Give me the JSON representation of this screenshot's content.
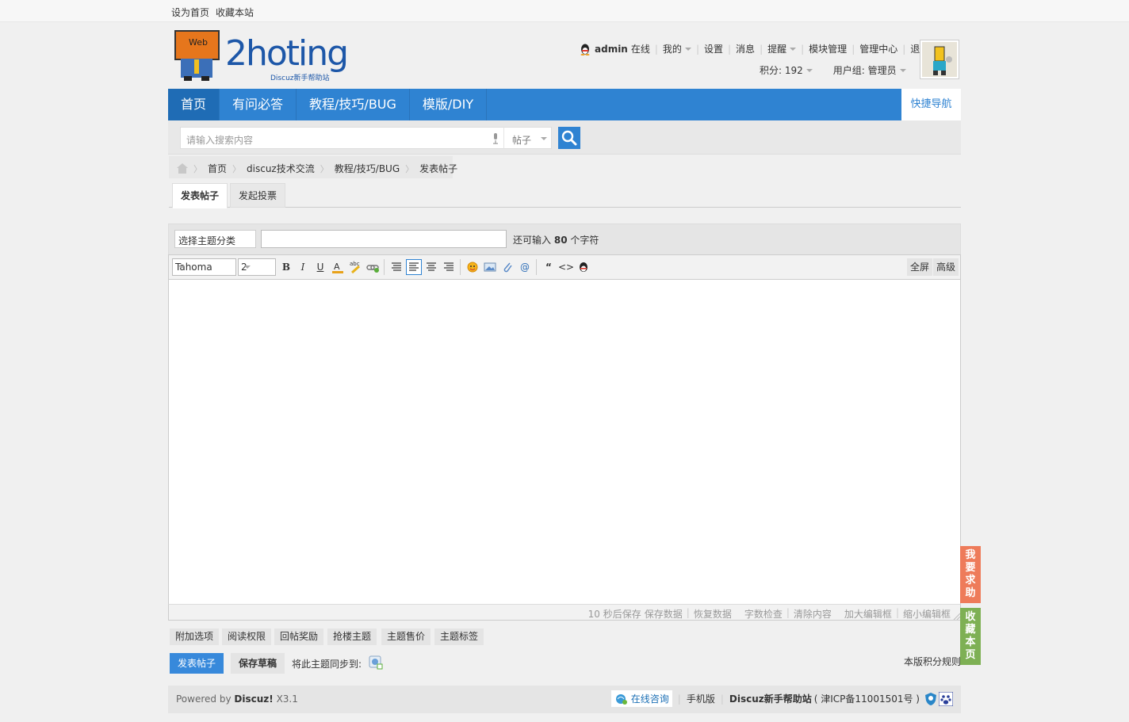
{
  "topbar": {
    "set_home": "设为首页",
    "bookmark": "收藏本站"
  },
  "logo": {
    "word": "2hoting",
    "sub": "Discuz新手帮助站",
    "sign": "Web"
  },
  "user": {
    "name": "admin",
    "status": "在线",
    "menu": [
      "我的",
      "设置",
      "消息",
      "提醒",
      "模块管理",
      "管理中心",
      "退出"
    ],
    "credits": "积分: 192",
    "group": "用户组: 管理员"
  },
  "nav": {
    "items": [
      "首页",
      "有问必答",
      "教程/技巧/BUG",
      "模版/DIY"
    ],
    "quick": "快捷导航"
  },
  "search": {
    "placeholder": "请输入搜索内容",
    "type": "帖子"
  },
  "breadcrumb": [
    "首页",
    "discuz技术交流",
    "教程/技巧/BUG",
    "发表帖子"
  ],
  "tabs": [
    "发表帖子",
    "发起投票"
  ],
  "post": {
    "type_select": "选择主题分类",
    "subject_value": "",
    "remain_prefix": "还可输入",
    "remain_count": "80",
    "remain_suffix": "个字符"
  },
  "editor": {
    "font": "Tahoma",
    "size": "2",
    "fullscreen": "全屏",
    "advanced": "高级",
    "status": {
      "autosave": "10 秒后保存",
      "save": "保存数据",
      "restore": "恢复数据",
      "check": "字数检查",
      "clear": "清除内容",
      "enlarge": "加大编辑框",
      "shrink": "缩小编辑框"
    }
  },
  "extras": [
    "附加选项",
    "阅读权限",
    "回帖奖励",
    "抢楼主题",
    "主题售价",
    "主题标签"
  ],
  "actions": {
    "submit": "发表帖子",
    "draft": "保存草稿",
    "sync": "将此主题同步到:",
    "rules": "本版积分规则"
  },
  "side": {
    "help": [
      "我",
      "要",
      "求",
      "助"
    ],
    "fav": [
      "收",
      "藏",
      "本",
      "页"
    ]
  },
  "footer": {
    "powered_prefix": "Powered by",
    "powered_brand": "Discuz!",
    "version": "X3.1",
    "consult": "在线咨询",
    "mobile": "手机版",
    "site": "Discuz新手帮助站",
    "icp": "( 津ICP备11001501号 )"
  },
  "colors": {
    "brand_blue": "#2f83d2",
    "help_orange": "#ee7b5a",
    "fav_green": "#7eb054"
  }
}
